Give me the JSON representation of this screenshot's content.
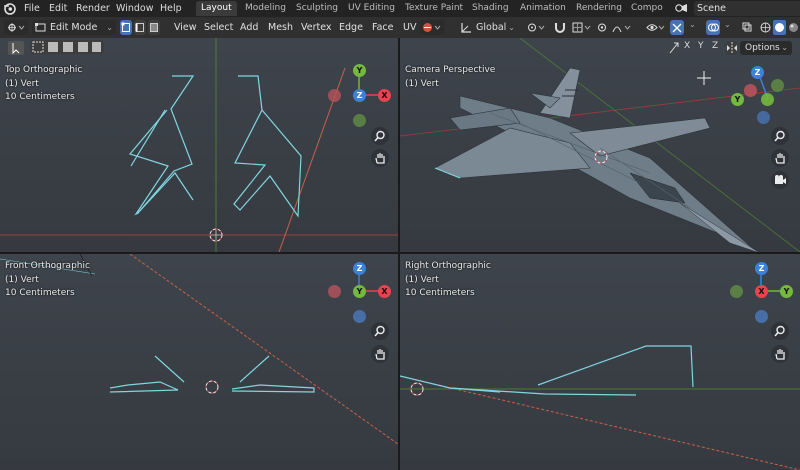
{
  "menu": {
    "items": [
      "File",
      "Edit",
      "Render",
      "Window",
      "Help"
    ]
  },
  "workspaces": [
    "Layout",
    "Modeling",
    "Sculpting",
    "UV Editing",
    "Texture Paint",
    "Shading",
    "Animation",
    "Rendering",
    "Compo"
  ],
  "scene": {
    "label": "Scene"
  },
  "toolbar": {
    "mode": "Edit Mode",
    "menus": [
      "View",
      "Select",
      "Add",
      "Mesh",
      "Vertex",
      "Edge",
      "Face",
      "UV"
    ],
    "transform_orientation": "Global"
  },
  "viewport_header": {
    "axes": [
      "X",
      "Y",
      "Z"
    ],
    "options_label": "Options"
  },
  "viewports": {
    "top_left": {
      "view": "Top Orthographic",
      "selection": "(1) Vert",
      "scale": "10 Centimeters"
    },
    "top_right": {
      "view": "Camera Perspective",
      "selection": "(1) Vert"
    },
    "bottom_left": {
      "view": "Front Orthographic",
      "selection": "(1) Vert",
      "scale": "10 Centimeters"
    },
    "bottom_right": {
      "view": "Right Orthographic",
      "selection": "(1) Vert",
      "scale": "10 Centimeters"
    }
  },
  "gizmo": {
    "colors": {
      "x": "#e8434f",
      "y": "#74b83e",
      "z": "#3b82d9",
      "neg_x": "#b7525a",
      "neg_y": "#5f8a45",
      "neg_z": "#476ea5"
    },
    "labels": {
      "top": {
        "x": "X",
        "y": "Y",
        "z": "Z"
      },
      "camera": {
        "z": "Z",
        "y": "Y"
      },
      "front": {
        "x": "X",
        "y": "Y",
        "z": "Z"
      },
      "right": {
        "x": "X",
        "y": "Y",
        "z": "Z"
      }
    }
  },
  "colors": {
    "accent": "#4772b3",
    "mesh_edge": "#7fd6e0",
    "x_axis_line": "#c0443f",
    "y_axis_line": "#5a9a3a"
  }
}
